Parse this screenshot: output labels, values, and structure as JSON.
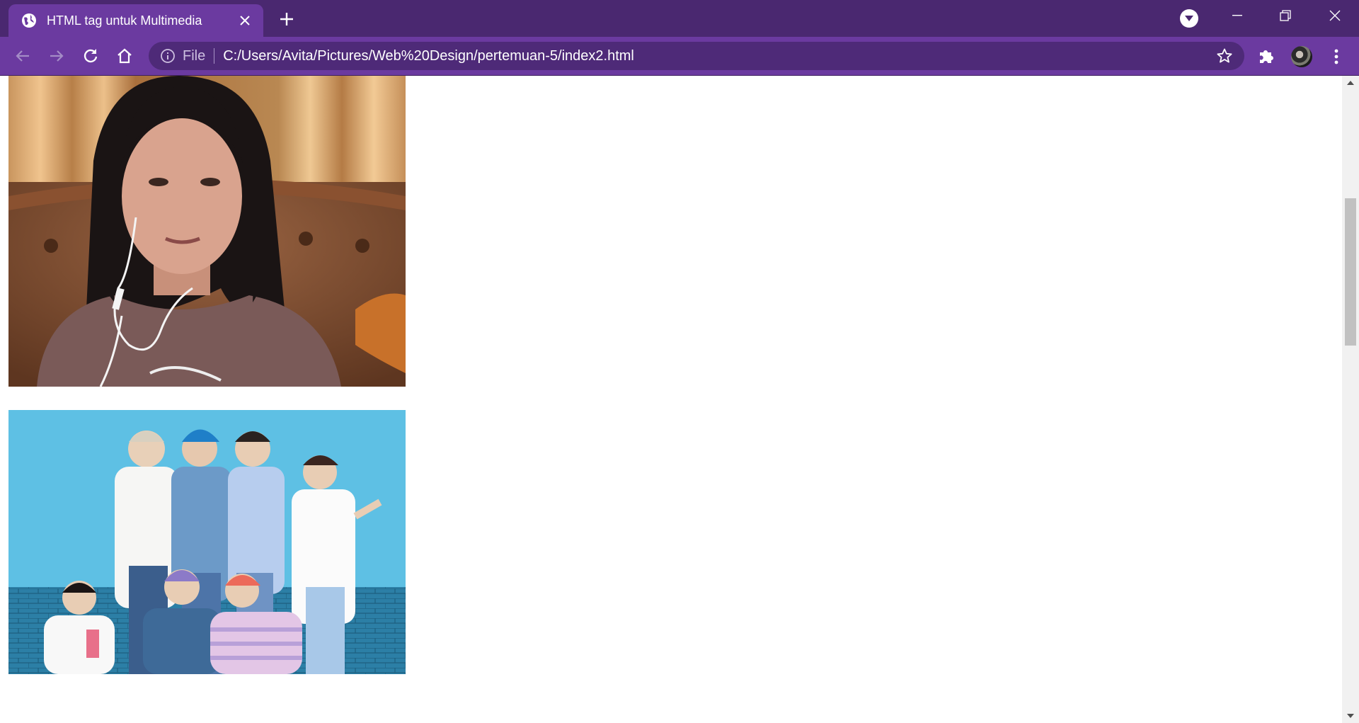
{
  "browser": {
    "tab_title": "HTML tag untuk Multimedia",
    "omnibox": {
      "scheme_label": "File",
      "url": "C:/Users/Avita/Pictures/Web%20Design/pertemuan-5/index2.html"
    }
  },
  "page": {
    "images": [
      {
        "description": "selfie-photo",
        "icon": "portrait-photo"
      },
      {
        "description": "group-photo",
        "icon": "group-photo"
      }
    ]
  },
  "colors": {
    "tabbar": "#4a2870",
    "toolbar": "#6b3aa0",
    "omnibox": "#4e2a78"
  }
}
